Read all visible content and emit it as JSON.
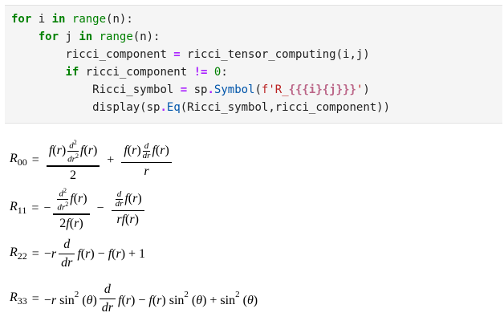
{
  "code_lines": [
    {
      "indent": "",
      "tokens": [
        {
          "t": "for",
          "c": "kw"
        },
        {
          "t": " i ",
          "c": ""
        },
        {
          "t": "in",
          "c": "kw"
        },
        {
          "t": " ",
          "c": ""
        },
        {
          "t": "range",
          "c": "bi"
        },
        {
          "t": "(n):",
          "c": ""
        }
      ]
    },
    {
      "indent": "    ",
      "tokens": [
        {
          "t": "for",
          "c": "kw"
        },
        {
          "t": " j ",
          "c": ""
        },
        {
          "t": "in",
          "c": "kw"
        },
        {
          "t": " ",
          "c": ""
        },
        {
          "t": "range",
          "c": "bi"
        },
        {
          "t": "(n):",
          "c": ""
        }
      ]
    },
    {
      "indent": "        ",
      "tokens": [
        {
          "t": "ricci_component ",
          "c": ""
        },
        {
          "t": "=",
          "c": "op"
        },
        {
          "t": " ricci_tensor_computing(i,j)",
          "c": ""
        }
      ]
    },
    {
      "indent": "        ",
      "tokens": [
        {
          "t": "if",
          "c": "kw"
        },
        {
          "t": " ricci_component ",
          "c": ""
        },
        {
          "t": "!=",
          "c": "op"
        },
        {
          "t": " ",
          "c": ""
        },
        {
          "t": "0",
          "c": "num"
        },
        {
          "t": ":",
          "c": ""
        }
      ]
    },
    {
      "indent": "            ",
      "tokens": [
        {
          "t": "Ricci_symbol ",
          "c": ""
        },
        {
          "t": "=",
          "c": "op"
        },
        {
          "t": " sp",
          "c": ""
        },
        {
          "t": ".",
          "c": "op"
        },
        {
          "t": "Symbol",
          "c": "attr"
        },
        {
          "t": "(",
          "c": ""
        },
        {
          "t": "f'R_",
          "c": "str"
        },
        {
          "t": "{{",
          "c": "esc"
        },
        {
          "t": "{i}",
          "c": "esc"
        },
        {
          "t": "{j}",
          "c": "esc"
        },
        {
          "t": "}}",
          "c": "esc"
        },
        {
          "t": "'",
          "c": "str"
        },
        {
          "t": ")",
          "c": ""
        }
      ]
    },
    {
      "indent": "            ",
      "tokens": [
        {
          "t": "display(sp",
          "c": ""
        },
        {
          "t": ".",
          "c": "op"
        },
        {
          "t": "Eq",
          "c": "attr"
        },
        {
          "t": "(Ricci_symbol,ricci_component))",
          "c": ""
        }
      ]
    }
  ],
  "equations": {
    "r00": {
      "lhs": "R",
      "sub": "00"
    },
    "r11": {
      "lhs": "R",
      "sub": "11"
    },
    "r22": {
      "lhs": "R",
      "sub": "22"
    },
    "r33": {
      "lhs": "R",
      "sub": "33"
    }
  },
  "colors": {
    "keyword": "#008000",
    "operator": "#aa22ff",
    "string": "#ba2121",
    "attribute": "#0055aa",
    "cell_background": "#f5f5f5"
  }
}
